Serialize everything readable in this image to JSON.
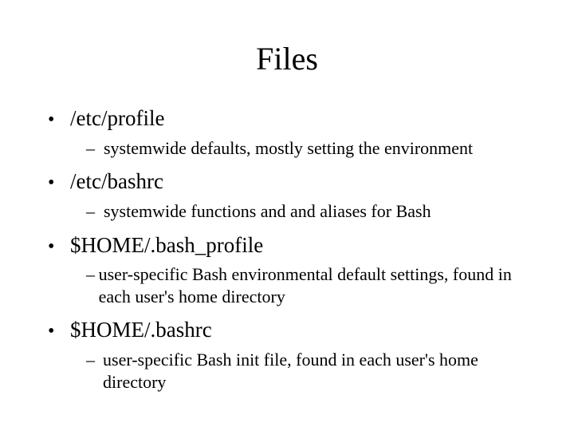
{
  "title": "Files",
  "items": [
    {
      "label": "/etc/profile",
      "sub": "systemwide defaults, mostly setting the environment"
    },
    {
      "label": "/etc/bashrc",
      "sub": "systemwide functions and and aliases for Bash"
    },
    {
      "label": "$HOME/.bash_profile",
      "sub": "user-specific Bash environmental default settings, found in each user's home directory"
    },
    {
      "label": "$HOME/.bashrc",
      "sub": "user-specific Bash init file, found in each user's home directory"
    }
  ]
}
